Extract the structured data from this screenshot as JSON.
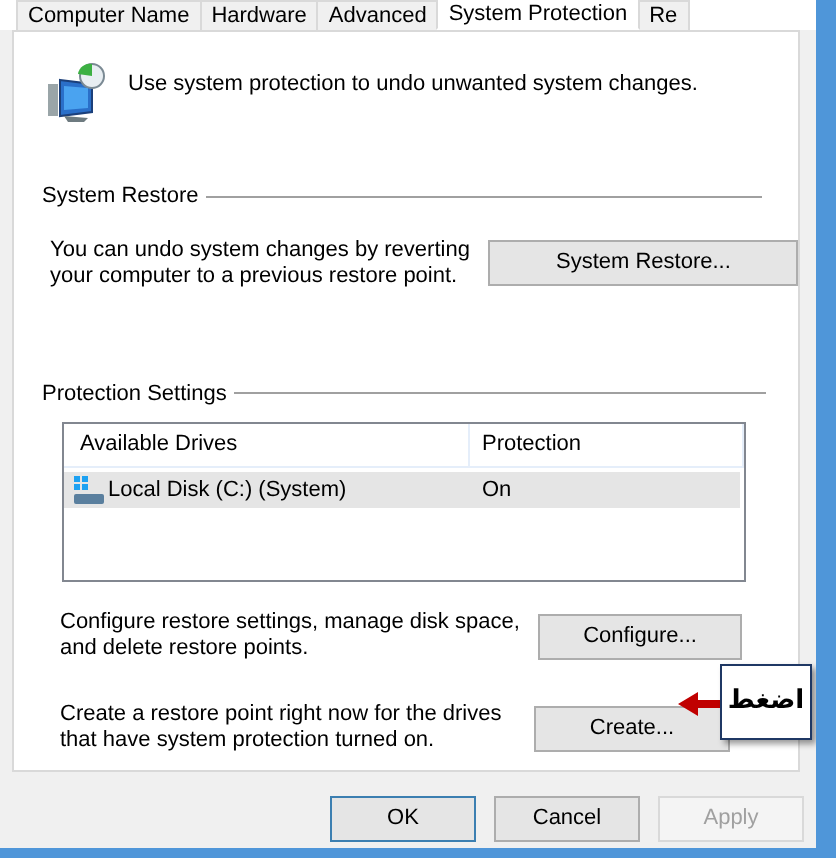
{
  "tabs": [
    {
      "label": "Computer Name",
      "selected": false
    },
    {
      "label": "Hardware",
      "selected": false
    },
    {
      "label": "Advanced",
      "selected": false
    },
    {
      "label": "System Protection",
      "selected": true
    },
    {
      "label": "Re",
      "selected": false
    }
  ],
  "intro": "Use system protection to undo unwanted system changes.",
  "system_restore": {
    "title": "System Restore",
    "description": "You can undo system changes by reverting your computer to a previous restore point.",
    "button": "System Restore..."
  },
  "protection_settings": {
    "title": "Protection Settings",
    "table": {
      "columns": [
        "Available Drives",
        "Protection"
      ],
      "rows": [
        {
          "drive": "Local Disk (C:) (System)",
          "protection": "On",
          "selected": true
        }
      ]
    },
    "configure": {
      "description": "Configure restore settings, manage disk space, and delete restore points.",
      "button": "Configure..."
    },
    "create": {
      "description": "Create a restore point right now for the drives that have system protection turned on.",
      "button": "Create..."
    }
  },
  "callout": {
    "text": "اضغط"
  },
  "buttons": [
    {
      "label": "OK",
      "disabled": false,
      "default": true
    },
    {
      "label": "Cancel",
      "disabled": false,
      "default": false
    },
    {
      "label": "Apply",
      "disabled": true,
      "default": false
    }
  ]
}
